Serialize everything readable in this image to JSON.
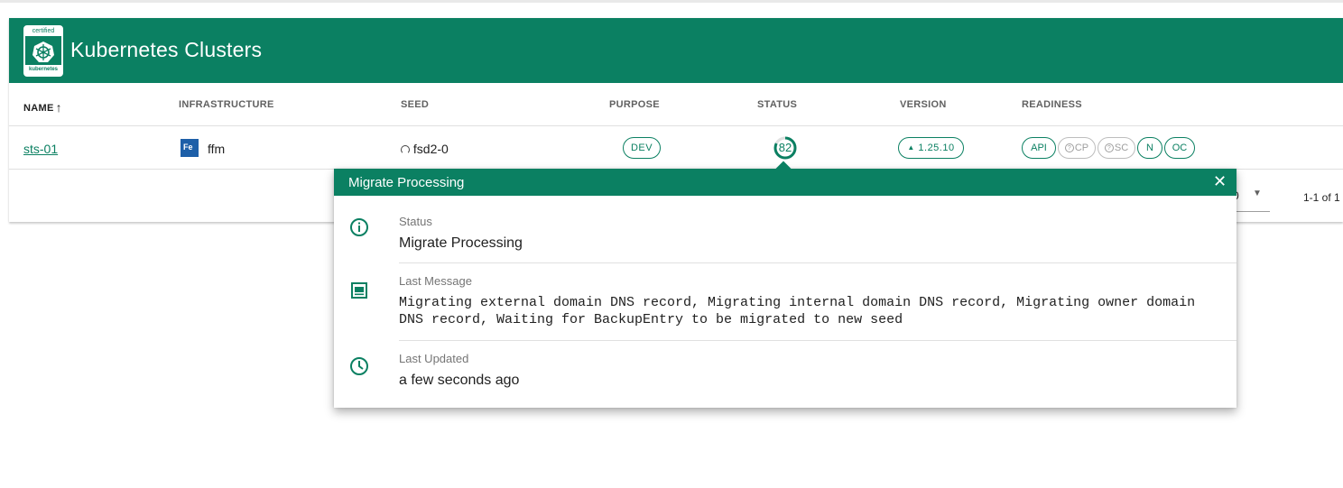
{
  "app": {
    "title": "Kubernetes Clusters",
    "logo_top_text": "certified",
    "logo_bottom_text": "kubernetes"
  },
  "table": {
    "headers": {
      "name": "NAME",
      "infrastructure": "INFRASTRUCTURE",
      "seed": "SEED",
      "purpose": "PURPOSE",
      "status": "STATUS",
      "version": "VERSION",
      "readiness": "READINESS"
    },
    "sort_icon": "arrow-up-icon",
    "rows": [
      {
        "name": "sts-01",
        "infra_badge": "Fe",
        "infra": "ffm",
        "seed_icon": "spinner-icon",
        "seed": "fsd2-0",
        "purpose": "DEV",
        "status_progress": 82,
        "status_progress_label": "82",
        "version": "1.25.10",
        "version_icon": "caret-up-icon",
        "readiness": [
          {
            "label": "API",
            "state": "ok"
          },
          {
            "label": "CP",
            "state": "unknown"
          },
          {
            "label": "SC",
            "state": "unknown"
          },
          {
            "label": "N",
            "state": "ok"
          },
          {
            "label": "OC",
            "state": "ok"
          }
        ]
      }
    ]
  },
  "footer": {
    "rows_per_page": "0",
    "page_info": "1-1 of 1"
  },
  "popup": {
    "title": "Migrate Processing",
    "status_label": "Status",
    "status_value": "Migrate Processing",
    "message_label": "Last Message",
    "message_value": "Migrating external domain DNS record, Migrating internal domain DNS record, Migrating owner domain DNS record, Waiting for BackupEntry to be migrated to new seed",
    "updated_label": "Last Updated",
    "updated_value": "a few seconds ago"
  },
  "colors": {
    "primary": "#0b8062",
    "text": "#212121",
    "muted": "#757575",
    "disabled": "#bdbdbd"
  }
}
